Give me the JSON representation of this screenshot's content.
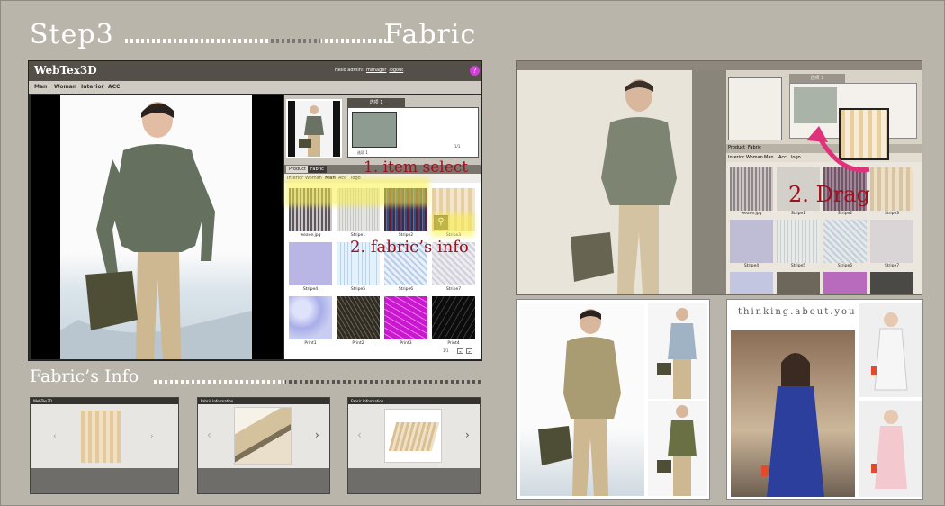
{
  "heading": {
    "step": "Step3",
    "topic": "Fabric"
  },
  "subheading": "Fabric’s Info",
  "app": {
    "brand": "WebTex3D",
    "greeting": "Hello admin!",
    "manager_link": "manager",
    "logout_link": "logout",
    "help_icon": "?",
    "nav": [
      "Man",
      "Woman",
      "Interior",
      "ACC"
    ],
    "selected_panel_tab": "选项 1",
    "selected_label": "选项 1",
    "pager_top": "1/1",
    "panel_tabs": [
      "Product",
      "Fabric"
    ],
    "categories": [
      "Interior",
      "Woman",
      "Man",
      "Acc",
      "logo"
    ],
    "swatches": [
      {
        "label": "weave.jpg",
        "color": "#7b7479"
      },
      {
        "label": "Stripe1",
        "color": "#d0d0cf"
      },
      {
        "label": "Stripe2",
        "color": "#5a3453"
      },
      {
        "label": "Stripe3",
        "color": "#dbc08f"
      },
      {
        "label": "Stripe4",
        "color": "#b9b6e6"
      },
      {
        "label": "Stripe5",
        "color": "#d2e4ef"
      },
      {
        "label": "Stripe6",
        "color": "#c7d8ec"
      },
      {
        "label": "Stripe7",
        "color": "#ddd9e3"
      },
      {
        "label": "Print1",
        "color": "#b3b8ec"
      },
      {
        "label": "Print2",
        "color": "#443f35"
      },
      {
        "label": "Print3",
        "color": "#d21fd8"
      },
      {
        "label": "Print4",
        "color": "#111111"
      }
    ],
    "pager_bottom": "1/1"
  },
  "annotations": {
    "item_select": "1. item select",
    "fabric_info": "2. fabric’s info",
    "drag": "2. Drag"
  },
  "right": {
    "selected_tab": "选项 1",
    "panel_tabs": [
      "Product",
      "Fabric"
    ],
    "categories": [
      "Interior",
      "Woman",
      "Man",
      "Acc",
      "logo"
    ],
    "swatch_labels": [
      "weave.jpg",
      "Stripe1",
      "Stripe2",
      "Stripe3",
      "Stripe4",
      "Stripe5",
      "Stripe6",
      "Stripe7"
    ],
    "magazine_title": "thinking.about.you"
  },
  "info_screens": [
    {
      "brand": "WebTex3D"
    },
    {
      "brand": "Fabric Information"
    },
    {
      "brand": "Fabric Information"
    }
  ],
  "colors": {
    "annotation": "#9b1220",
    "highlight": "#f7ec3e",
    "arrow": "#e0327a"
  }
}
